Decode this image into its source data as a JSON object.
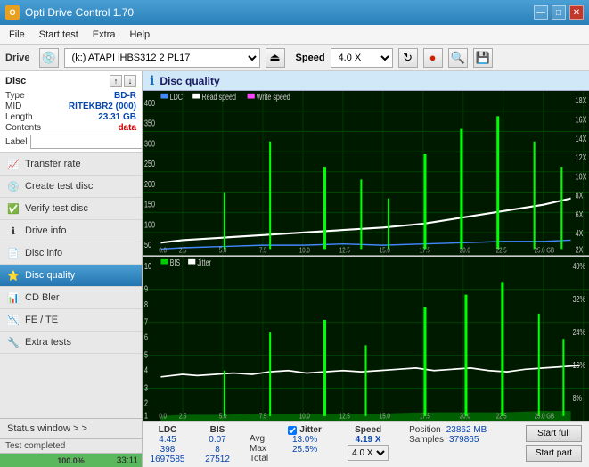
{
  "app": {
    "title": "Opti Drive Control 1.70",
    "icon": "O"
  },
  "titlebar": {
    "minimize": "—",
    "maximize": "□",
    "close": "✕"
  },
  "menu": {
    "items": [
      "File",
      "Start test",
      "Extra",
      "Help"
    ]
  },
  "toolbar": {
    "drive_label": "Drive",
    "drive_value": "(k:)  ATAPI iHBS312  2 PL17",
    "speed_label": "Speed",
    "speed_value": "4.0 X"
  },
  "disc": {
    "title": "Disc",
    "type_label": "Type",
    "type_value": "BD-R",
    "mid_label": "MID",
    "mid_value": "RITEKBR2 (000)",
    "length_label": "Length",
    "length_value": "23.31 GB",
    "contents_label": "Contents",
    "contents_value": "data",
    "label_label": "Label",
    "label_placeholder": ""
  },
  "nav": {
    "items": [
      {
        "id": "transfer-rate",
        "label": "Transfer rate",
        "icon": "📈"
      },
      {
        "id": "create-test-disc",
        "label": "Create test disc",
        "icon": "💿"
      },
      {
        "id": "verify-test-disc",
        "label": "Verify test disc",
        "icon": "✅"
      },
      {
        "id": "drive-info",
        "label": "Drive info",
        "icon": "ℹ"
      },
      {
        "id": "disc-info",
        "label": "Disc info",
        "icon": "📄"
      },
      {
        "id": "disc-quality",
        "label": "Disc quality",
        "icon": "⭐",
        "active": true
      },
      {
        "id": "cd-bler",
        "label": "CD Bler",
        "icon": "📊"
      },
      {
        "id": "fe-te",
        "label": "FE / TE",
        "icon": "📉"
      },
      {
        "id": "extra-tests",
        "label": "Extra tests",
        "icon": "🔧"
      }
    ]
  },
  "status_window": {
    "label": "Status window > >"
  },
  "status": {
    "completed_text": "Test completed",
    "progress_percent": "100.0%",
    "time": "33:11"
  },
  "chart": {
    "title": "Disc quality",
    "top": {
      "legend": [
        "LDC",
        "Read speed",
        "Write speed"
      ],
      "y_max": 400,
      "y_right_labels": [
        "18X",
        "16X",
        "14X",
        "12X",
        "10X",
        "8X",
        "6X",
        "4X",
        "2X"
      ],
      "x_labels": [
        "0.0",
        "2.5",
        "5.0",
        "7.5",
        "10.0",
        "12.5",
        "15.0",
        "17.5",
        "20.0",
        "22.5",
        "25.0 GB"
      ]
    },
    "bottom": {
      "legend": [
        "BIS",
        "Jitter"
      ],
      "y_max": 10,
      "y_right_labels": [
        "40%",
        "32%",
        "24%",
        "16%",
        "8%"
      ],
      "x_labels": [
        "0.0",
        "2.5",
        "5.0",
        "7.5",
        "10.0",
        "12.5",
        "15.0",
        "17.5",
        "20.0",
        "22.5",
        "25.0 GB"
      ]
    }
  },
  "stats": {
    "columns": {
      "ldc": {
        "header": "LDC",
        "avg": "4.45",
        "max": "398",
        "total": "1697585"
      },
      "bis": {
        "header": "BIS",
        "avg": "0.07",
        "max": "8",
        "total": "27512"
      },
      "jitter": {
        "header": "Jitter",
        "avg": "13.0%",
        "max": "25.5%"
      },
      "speed": {
        "header": "Speed",
        "value": "4.19 X",
        "select": "4.0 X"
      },
      "position": {
        "label": "Position",
        "value": "23862 MB"
      },
      "samples": {
        "label": "Samples",
        "value": "379865"
      }
    },
    "jitter_checked": true,
    "avg_label": "Avg",
    "max_label": "Max",
    "total_label": "Total",
    "start_full": "Start full",
    "start_part": "Start part"
  }
}
